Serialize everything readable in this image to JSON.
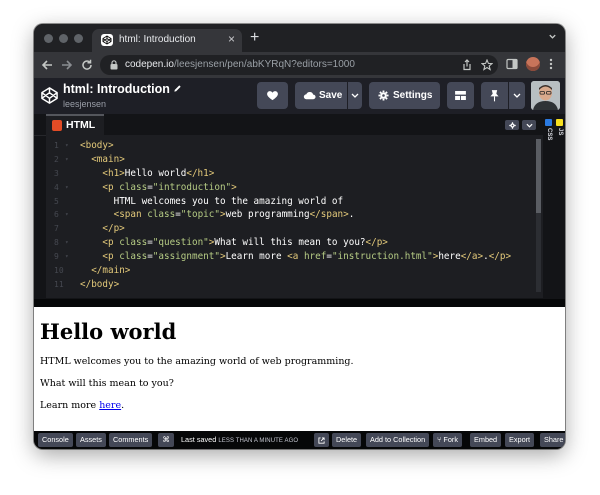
{
  "browser": {
    "tab_title": "html: Introduction",
    "tab_close": "×",
    "new_tab": "+",
    "url_domain": "codepen.io",
    "url_path": "/leesjensen/pen/abKYRqN?editors=1000"
  },
  "codepen": {
    "pen_title": "html: Introduction",
    "user": "leesjensen",
    "save_label": "Save",
    "settings_label": "Settings"
  },
  "editor": {
    "tab_label": "HTML",
    "side_panels": [
      {
        "label": "CSS",
        "color": "#2a7ae2"
      },
      {
        "label": "JS",
        "color": "#f7df1e"
      }
    ],
    "line_numbers": [
      "1",
      "2",
      "3",
      "4",
      "5",
      "6",
      "7",
      "8",
      "9",
      "10",
      "11"
    ],
    "lines": [
      {
        "indent": "",
        "tokens": [
          {
            "t": "tag",
            "v": "<body>"
          }
        ]
      },
      {
        "indent": "  ",
        "tokens": [
          {
            "t": "tag",
            "v": "<main>"
          }
        ]
      },
      {
        "indent": "    ",
        "tokens": [
          {
            "t": "tag",
            "v": "<h1>"
          },
          {
            "t": "txt",
            "v": "Hello world"
          },
          {
            "t": "tag",
            "v": "</h1>"
          }
        ]
      },
      {
        "indent": "    ",
        "tokens": [
          {
            "t": "tag",
            "v": "<p "
          },
          {
            "t": "attr",
            "v": "class"
          },
          {
            "t": "eq",
            "v": "="
          },
          {
            "t": "str",
            "v": "\"introduction\""
          },
          {
            "t": "tag",
            "v": ">"
          }
        ]
      },
      {
        "indent": "      ",
        "tokens": [
          {
            "t": "txt",
            "v": "HTML welcomes you to the amazing world of"
          }
        ]
      },
      {
        "indent": "      ",
        "tokens": [
          {
            "t": "tag",
            "v": "<span "
          },
          {
            "t": "attr",
            "v": "class"
          },
          {
            "t": "eq",
            "v": "="
          },
          {
            "t": "str",
            "v": "\"topic\""
          },
          {
            "t": "tag",
            "v": ">"
          },
          {
            "t": "txt",
            "v": "web programming"
          },
          {
            "t": "tag",
            "v": "</span>"
          },
          {
            "t": "txt",
            "v": "."
          }
        ]
      },
      {
        "indent": "    ",
        "tokens": [
          {
            "t": "tag",
            "v": "</p>"
          }
        ]
      },
      {
        "indent": "    ",
        "tokens": [
          {
            "t": "tag",
            "v": "<p "
          },
          {
            "t": "attr",
            "v": "class"
          },
          {
            "t": "eq",
            "v": "="
          },
          {
            "t": "str",
            "v": "\"question\""
          },
          {
            "t": "tag",
            "v": ">"
          },
          {
            "t": "txt",
            "v": "What will this mean to you?"
          },
          {
            "t": "tag",
            "v": "</p>"
          }
        ]
      },
      {
        "indent": "    ",
        "tokens": [
          {
            "t": "tag",
            "v": "<p "
          },
          {
            "t": "attr",
            "v": "class"
          },
          {
            "t": "eq",
            "v": "="
          },
          {
            "t": "str",
            "v": "\"assignment\""
          },
          {
            "t": "tag",
            "v": ">"
          },
          {
            "t": "txt",
            "v": "Learn more "
          },
          {
            "t": "tag",
            "v": "<a "
          },
          {
            "t": "attr",
            "v": "href"
          },
          {
            "t": "eq",
            "v": "="
          },
          {
            "t": "str",
            "v": "\"instruction.html\""
          },
          {
            "t": "tag",
            "v": ">"
          },
          {
            "t": "txt",
            "v": "here"
          },
          {
            "t": "tag",
            "v": "</a>"
          },
          {
            "t": "txt",
            "v": "."
          },
          {
            "t": "tag",
            "v": "</p>"
          }
        ]
      },
      {
        "indent": "  ",
        "tokens": [
          {
            "t": "tag",
            "v": "</main>"
          }
        ]
      },
      {
        "indent": "",
        "tokens": [
          {
            "t": "tag",
            "v": "</body>"
          }
        ]
      }
    ]
  },
  "preview": {
    "heading": "Hello world",
    "introduction": "HTML welcomes you to the amazing world of web programming.",
    "question": "What will this mean to you?",
    "assignment_prefix": "Learn more ",
    "assignment_link": "here",
    "assignment_suffix": "."
  },
  "bottom_bar": {
    "console": "Console",
    "assets": "Assets",
    "comments": "Comments",
    "shortcut_icon": "⌘",
    "last_saved": "Last saved",
    "last_saved_ago": "LESS THAN A MINUTE AGO",
    "delete": "Delete",
    "add_to_collection": "Add to Collection",
    "fork": "Fork",
    "fork_icon": "⑂",
    "embed": "Embed",
    "export": "Export",
    "share": "Share"
  }
}
